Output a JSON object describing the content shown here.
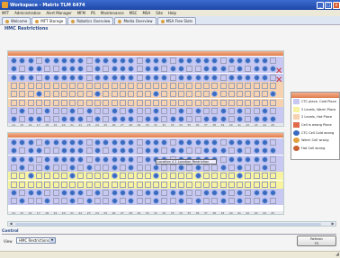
{
  "window": {
    "title": "Workspace - Matrix TLM 6474",
    "minimize": "_",
    "maximize": "□",
    "close": "x"
  },
  "menu": [
    "MFT",
    "Administration",
    "Alert Manager",
    "MFM",
    "PS",
    "Maintenance",
    "MSC",
    "MSA",
    "Site",
    "Help"
  ],
  "tabs": [
    {
      "label": "Welcome",
      "active": false
    },
    {
      "label": "MFT Storage",
      "active": true
    },
    {
      "label": "Robotics Overview",
      "active": false
    },
    {
      "label": "Media Overview",
      "active": false
    },
    {
      "label": "MSA Free Slots",
      "active": false
    }
  ],
  "page_title": "HMC Restrictions",
  "axis_labels": [
    "14",
    "15",
    "16",
    "17",
    "18",
    "19",
    "20",
    "21",
    "22",
    "23",
    "24",
    "25",
    "26",
    "27",
    "28",
    "29",
    "30",
    "31",
    "32",
    "33",
    "34",
    "35",
    "36",
    "37",
    "38",
    "39",
    "40",
    "41",
    "42",
    "43",
    "44",
    "45"
  ],
  "legend": {
    "items": [
      {
        "label": "CTC place, Cold Place",
        "color": "#c8c8f2",
        "shape": "square"
      },
      {
        "label": "2 Levels, Warm Place",
        "color": "#f7f3a0",
        "shape": "square"
      },
      {
        "label": "2 Levels, Hot Place",
        "color": "#f6d2b0",
        "shape": "square"
      },
      {
        "label": "Cell is wrong Place",
        "color": "#e06a4a",
        "shape": "square"
      },
      {
        "label": "CTC Cell Cold wrong",
        "color": "#3a6ac0",
        "shape": "circle"
      },
      {
        "label": "Warm Cell wrong",
        "color": "#e2a040",
        "shape": "circle"
      },
      {
        "label": "Hot Cell wrong",
        "color": "#c86030",
        "shape": "circle"
      }
    ]
  },
  "tooltip": "Location 4 2 Location-Restriction",
  "control": {
    "heading": "Control",
    "view_label": "View",
    "view_value": "HMC Restrictions",
    "refresh_label": "Refresh",
    "refresh_sub": "F5"
  },
  "colors": {
    "cold": "#c8c8f2",
    "warm": "#f7f3a0",
    "hot": "#f6d2b0",
    "empty": "#ffffff",
    "circle": "#3a6ac0",
    "accent": "#e07d4e"
  }
}
